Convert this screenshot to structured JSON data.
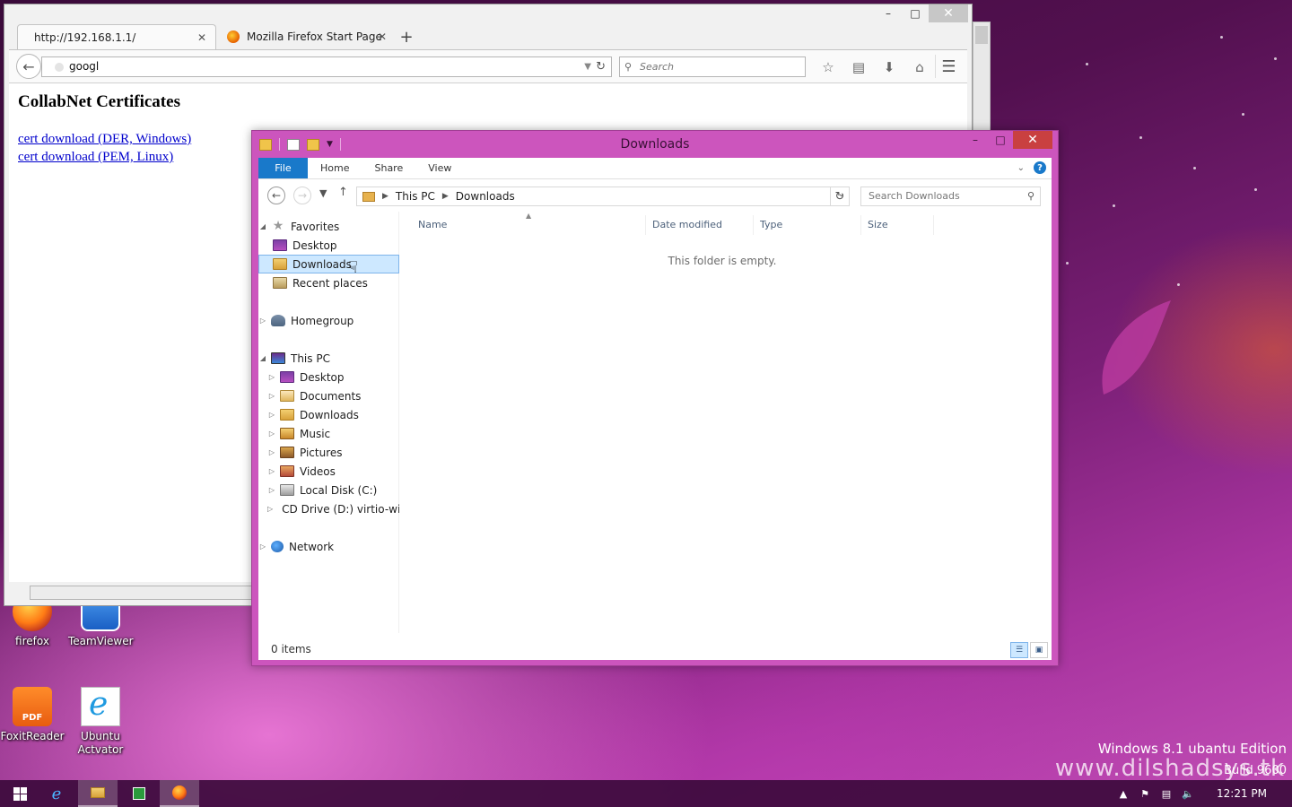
{
  "firefox": {
    "tabs": [
      {
        "label": "http://192.168.1.1/"
      },
      {
        "label": "Mozilla Firefox Start Page"
      }
    ],
    "url_value": "googl",
    "search_placeholder": "Search",
    "page_heading": "CollabNet Certificates",
    "links": [
      "cert download (DER, Windows)",
      "cert download (PEM, Linux)"
    ]
  },
  "explorer": {
    "title": "Downloads",
    "ribbon_tabs": [
      "File",
      "Home",
      "Share",
      "View"
    ],
    "address": [
      "This PC",
      "Downloads"
    ],
    "search_placeholder": "Search Downloads",
    "nav": {
      "favorites": "Favorites",
      "fav_items": [
        "Desktop",
        "Downloads",
        "Recent places"
      ],
      "homegroup": "Homegroup",
      "this_pc": "This PC",
      "pc_items": [
        "Desktop",
        "Documents",
        "Downloads",
        "Music",
        "Pictures",
        "Videos",
        "Local Disk (C:)",
        "CD Drive (D:) virtio-win"
      ],
      "network": "Network"
    },
    "columns": [
      "Name",
      "Date modified",
      "Type",
      "Size"
    ],
    "empty_message": "This folder is empty.",
    "status": "0 items"
  },
  "desktop_icons": [
    "firefox",
    "TeamViewer",
    "FoxitReader",
    "Ubuntu Actvator"
  ],
  "foxit_badge": "PDF",
  "watermark": {
    "edition": "Windows 8.1 ubantu Edition",
    "site": "www.dilshadsys.tk",
    "build": "Build 9600"
  },
  "taskbar": {
    "clock": "12:21 PM"
  },
  "colors": {
    "explorer_frame": "#cc55bd",
    "file_tab": "#1979ca",
    "link": "#0000cc"
  }
}
